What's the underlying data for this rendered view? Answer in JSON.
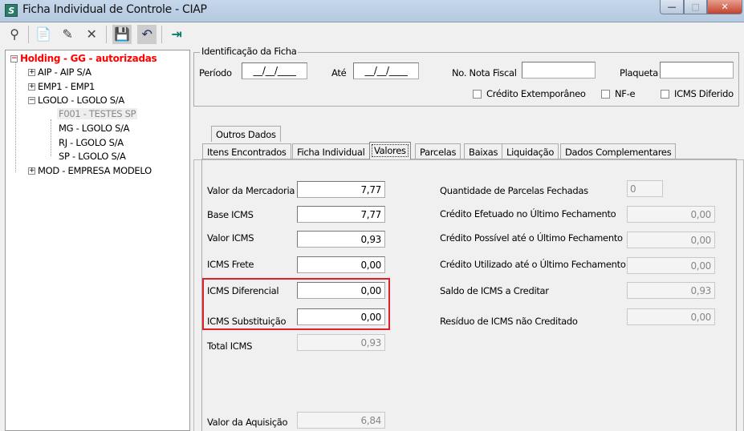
{
  "window": {
    "title": "Ficha Individual de Controle - CIAP",
    "app_icon": "S",
    "minimize": "—",
    "maximize": "□",
    "close": "✕"
  },
  "toolbar": {
    "icons": [
      "binoculars-icon",
      "new-icon",
      "edit-icon",
      "delete-icon",
      "save-icon",
      "undo-icon",
      "exit-icon"
    ],
    "glyphs": [
      "⚲",
      "📄",
      "✎",
      "✕",
      "💾",
      "↶",
      "⇥"
    ]
  },
  "tree": {
    "root": "Holding -  GG -  autorizadas",
    "items": [
      {
        "label": "AIP - AIP S/A",
        "toggle": "+"
      },
      {
        "label": "EMP1 - EMP1",
        "toggle": "+"
      },
      {
        "label": "LGOLO - LGOLO S/A",
        "toggle": "−"
      },
      {
        "label": "F001 - TESTES SP"
      },
      {
        "label": "MG - LGOLO S/A"
      },
      {
        "label": "RJ - LGOLO S/A"
      },
      {
        "label": "SP - LGOLO S/A"
      },
      {
        "label": "MOD - EMPRESA MODELO",
        "toggle": "+"
      }
    ],
    "root_toggle": "−",
    "root_color": "#ff0000"
  },
  "ident": {
    "legend": "Identificação da Ficha",
    "periodo_label": "Período",
    "periodo_value": "__/__/____",
    "ate_label": "Até",
    "ate_value": "__/__/____",
    "nota_label": "No. Nota Fiscal",
    "nota_value": "",
    "plaqueta_label": "Plaqueta",
    "plaqueta_value": "",
    "cb_credito": "Crédito Extemporâneo",
    "cb_nfe": "NF-e",
    "cb_icms": "ICMS Diferido"
  },
  "tabs": {
    "row1": [
      "Outros Dados"
    ],
    "row2": [
      "Itens Encontrados",
      "Ficha Individual",
      "Valores",
      "Parcelas",
      "Baixas",
      "Liquidação",
      "Dados Complementares"
    ],
    "active": "Valores"
  },
  "valores": {
    "left": [
      {
        "label": "Valor da Mercadoria",
        "value": "7,77"
      },
      {
        "label": "Base ICMS",
        "value": "7,77"
      },
      {
        "label": "Valor ICMS",
        "value": "0,93"
      },
      {
        "label": "ICMS Frete",
        "value": "0,00"
      },
      {
        "label": "ICMS Diferencial",
        "value": "0,00"
      },
      {
        "label": "ICMS Substituição",
        "value": "0,00"
      },
      {
        "label": "Total ICMS",
        "value": "0,93"
      },
      {
        "label": "Valor da Aquisição",
        "value": "6,84"
      }
    ],
    "right": [
      {
        "label": "Quantidade de Parcelas Fechadas",
        "value": "0"
      },
      {
        "label": "Crédito Efetuado no Último Fechamento",
        "value": "0,00"
      },
      {
        "label": "Crédito Possível até o Último Fechamento",
        "value": "0,00"
      },
      {
        "label": "Crédito Utilizado até o Último Fechamento",
        "value": "0,00"
      },
      {
        "label": "Saldo de ICMS a Creditar",
        "value": "0,93"
      },
      {
        "label": "Resíduo de ICMS não Creditado",
        "value": "0,00"
      }
    ]
  },
  "highlight_color": "#e0202a"
}
